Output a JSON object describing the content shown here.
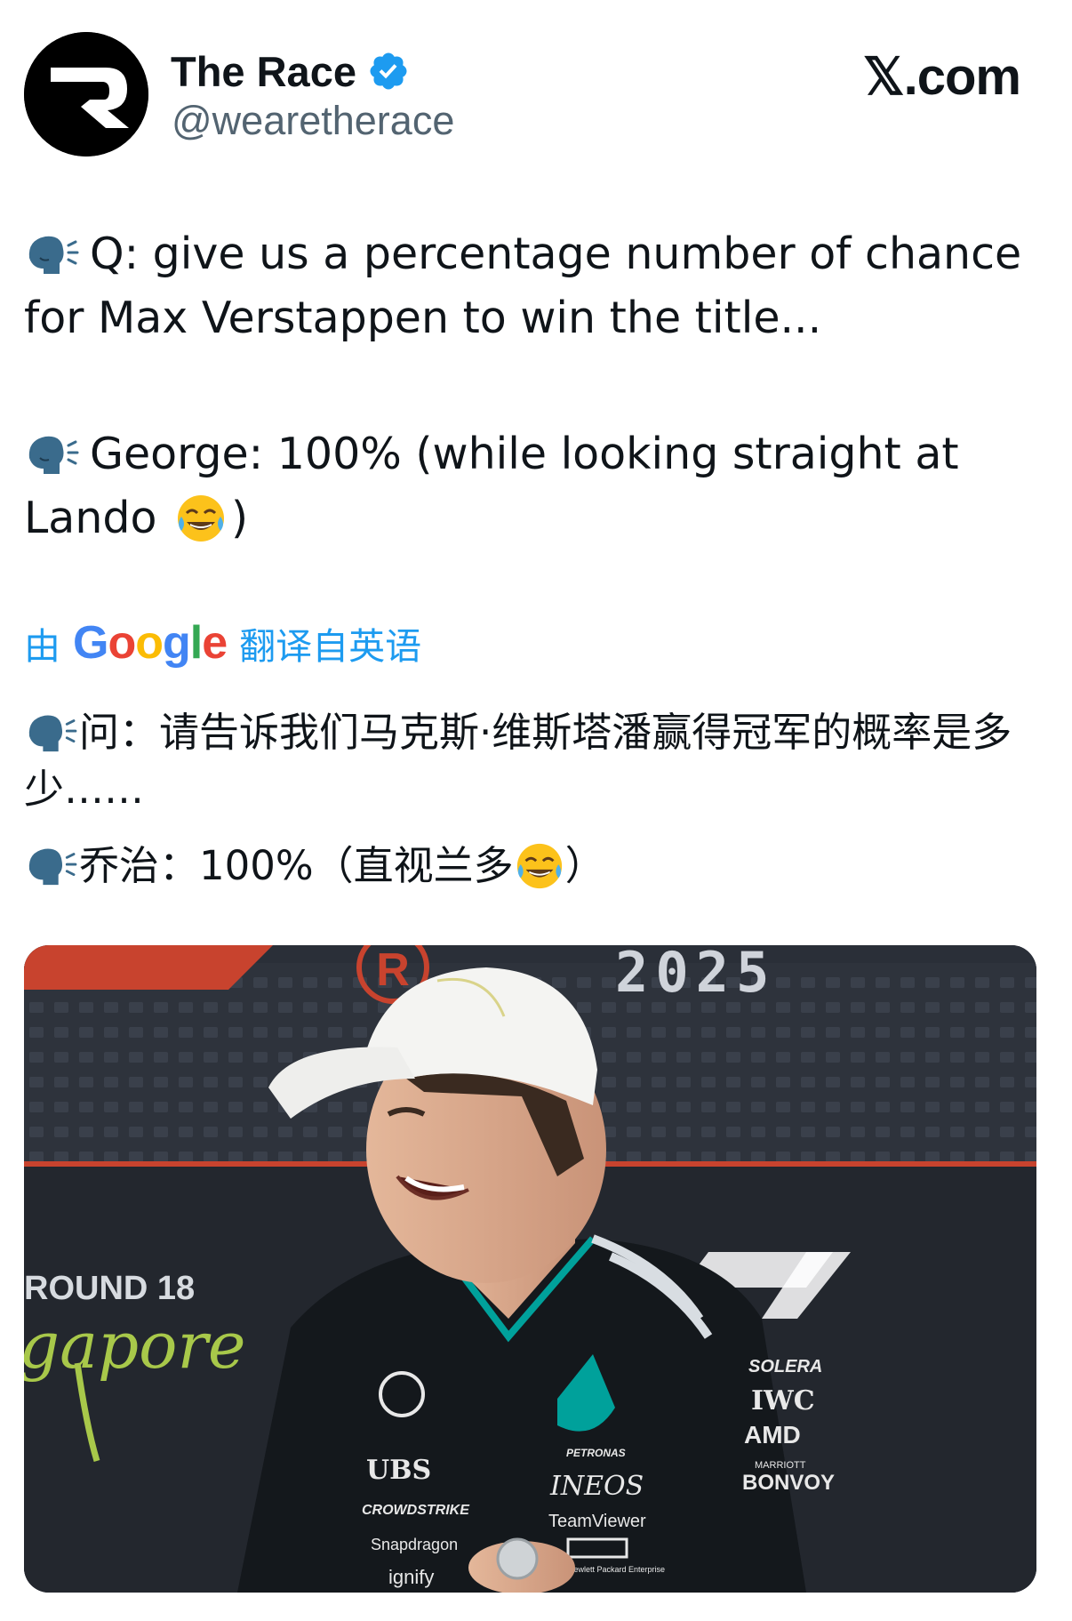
{
  "header": {
    "display_name": "The Race",
    "handle": "@wearetherace",
    "site_label": "𝕏.com",
    "verified_icon": "verified-badge-icon",
    "avatar_icon": "race-r-logo-icon"
  },
  "tweet": {
    "question_text": "Q: give us a percentage number of chance for Max Verstappen to win the title...",
    "answer_text_before_emoji": "George: 100% (while looking straight at Lando",
    "answer_text_after_emoji": ")",
    "speaker_icon": "speaking-head-icon",
    "emoji_icon": "tears-of-joy-emoji"
  },
  "translation": {
    "prefix": "由",
    "provider": "Google",
    "suffix": "翻译自英语",
    "question_text": "问：请告诉我们马克斯·维斯塔潘赢得冠军的概率是多少……",
    "answer_text_before_emoji": "乔治：100%（直视兰多",
    "answer_text_after_emoji": "）"
  },
  "media": {
    "backdrop_year": "2025",
    "round_label": "ROUND 18",
    "location_script": "gapore",
    "sponsors_left": [
      "UBS",
      "CROWDSTRIKE",
      "Snapdragon",
      "ignify"
    ],
    "sponsors_center": [
      "PETRONAS",
      "INEOS",
      "TeamViewer",
      "Hewlett Packard Enterprise"
    ],
    "sponsors_right": [
      "SOLERA",
      "IWC",
      "AMD",
      "MARRIOTT",
      "BONVOY"
    ],
    "colors": {
      "backdrop": "#2a2f38",
      "stripe": "#c8432e",
      "shirt": "#14181c",
      "accent_teal": "#00a19b"
    }
  },
  "colors": {
    "link_blue": "#1d9bf0",
    "text_primary": "#0f1419",
    "text_secondary": "#536471",
    "verified_blue": "#1d9bf0"
  }
}
